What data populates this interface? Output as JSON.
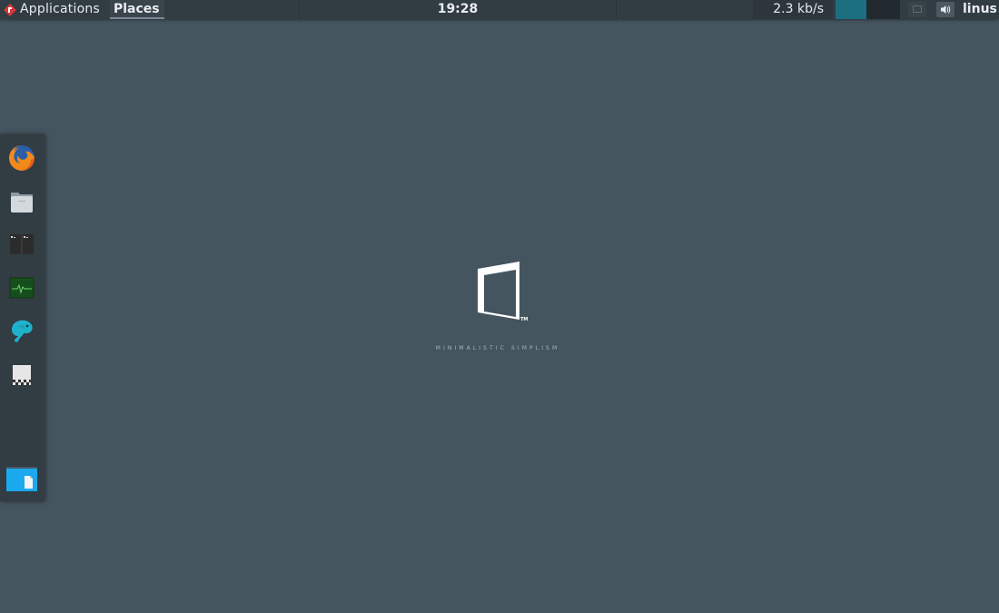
{
  "top_panel": {
    "applications_label": "Applications",
    "places_label": "Places",
    "clock": "19:28",
    "net_speed": "2.3 kb/s",
    "cpu_usage_fraction": 0.48,
    "user": "linus",
    "icons": {
      "app_menu": "app-menu-logo-icon",
      "tray": "window-list-icon",
      "volume": "volume-icon"
    }
  },
  "dock": {
    "items": [
      {
        "name": "firefox",
        "icon": "firefox-icon"
      },
      {
        "name": "files",
        "icon": "folder-icon"
      },
      {
        "name": "terminal",
        "icon": "terminal-icon"
      },
      {
        "name": "system-monitor",
        "icon": "system-monitor-icon"
      },
      {
        "name": "mastodon-client",
        "icon": "elephant-icon"
      },
      {
        "name": "document",
        "icon": "document-icon"
      },
      {
        "name": "file-manager",
        "icon": "file-manager-icon"
      }
    ]
  },
  "wallpaper": {
    "tagline": "MINIMALISTIC SIMPLISM",
    "trademark": "TM",
    "background_color": "#45555f"
  },
  "colors": {
    "panel": "#323c43",
    "accent": "#1c6f7f",
    "text": "#e8ecee"
  }
}
